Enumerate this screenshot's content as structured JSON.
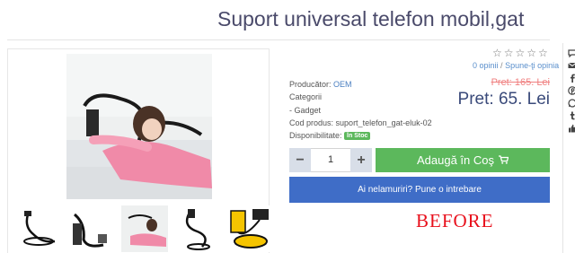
{
  "product": {
    "title": "Suport universal telefon mobil,gat"
  },
  "rating": {
    "stars": "☆☆☆☆☆",
    "reviews_link": "0 opinii",
    "separator": "/",
    "write_review_link": "Spune-ţi opinia"
  },
  "details": {
    "manufacturer_label": "Producător:",
    "manufacturer_value": "OEM",
    "categories_label": "Categorii",
    "category_item": "- Gadget",
    "product_code_label": "Cod produs:",
    "product_code_value": "suport_telefon_gat-eluk-02",
    "availability_label": "Disponibilitate:",
    "availability_value": "În Stoc"
  },
  "pricing": {
    "old_price": "Pret: 165. Lei",
    "price": "Pret: 65. Lei"
  },
  "cart": {
    "decrement_label": "−",
    "quantity": "1",
    "increment_label": "+",
    "add_to_cart_label": "Adaugă în Coş",
    "question_label": "Ai nelamuriri? Pune o intrebare"
  },
  "overlay": {
    "before_label": "BEFORE"
  },
  "colors": {
    "title": "#4a4a6a",
    "link": "#4a7fc0",
    "old_price": "#f08080",
    "price": "#3a4a7a",
    "stock_badge": "#5cb85c",
    "add_to_cart": "#5cb85c",
    "question_button": "#3f6dc7",
    "overlay_text": "#e8101c"
  },
  "icons": {
    "cart": "shopping-cart-icon",
    "share": [
      "chat-icon",
      "mail-icon",
      "facebook-icon",
      "pinterest-icon",
      "whatsapp-icon",
      "tumblr-icon",
      "like-icon"
    ]
  }
}
